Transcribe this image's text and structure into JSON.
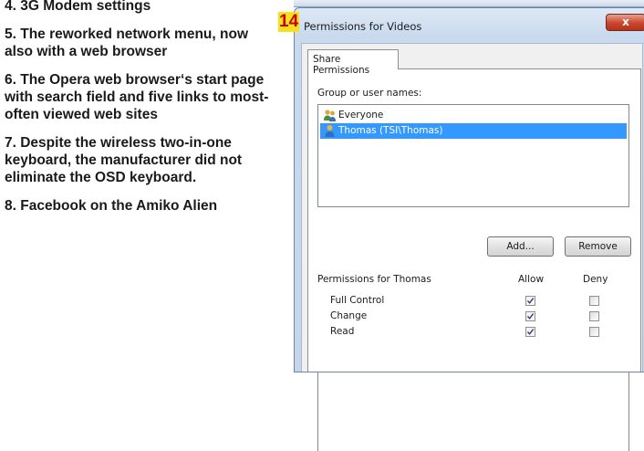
{
  "article": {
    "paragraphs": [
      "4. 3G Modem settings",
      "5. The reworked network menu, now also with a web browser",
      "6. The Opera web browser‘s start page with search field and five links to most-often viewed web sites",
      "7. Despite the wireless two-in-one keyboard, the manufacturer did not eliminate the OSD keyboard.",
      "8. Facebook on the Amiko Alien"
    ]
  },
  "badge": "14",
  "dialog": {
    "title": "Permissions for Videos",
    "close_label": "x",
    "tab_label": "Share Permissions",
    "group_label": "Group or user names:",
    "users": [
      {
        "name": "Everyone",
        "icon": "group-icon"
      },
      {
        "name": "Thomas (TSI\\Thomas)",
        "icon": "user-icon",
        "selected": true
      }
    ],
    "add_label": "Add...",
    "remove_label": "Remove",
    "permissions_label": "Permissions for Thomas",
    "allow_header": "Allow",
    "deny_header": "Deny",
    "permissions": [
      {
        "name": "Full Control",
        "allow": true,
        "deny": false
      },
      {
        "name": "Change",
        "allow": true,
        "deny": false
      },
      {
        "name": "Read",
        "allow": true,
        "deny": false
      }
    ]
  },
  "colors": {
    "selection": "#3399ff",
    "badge_bg": "#f7e21a",
    "badge_text": "#cc0000",
    "close_button": "#c9452c"
  }
}
